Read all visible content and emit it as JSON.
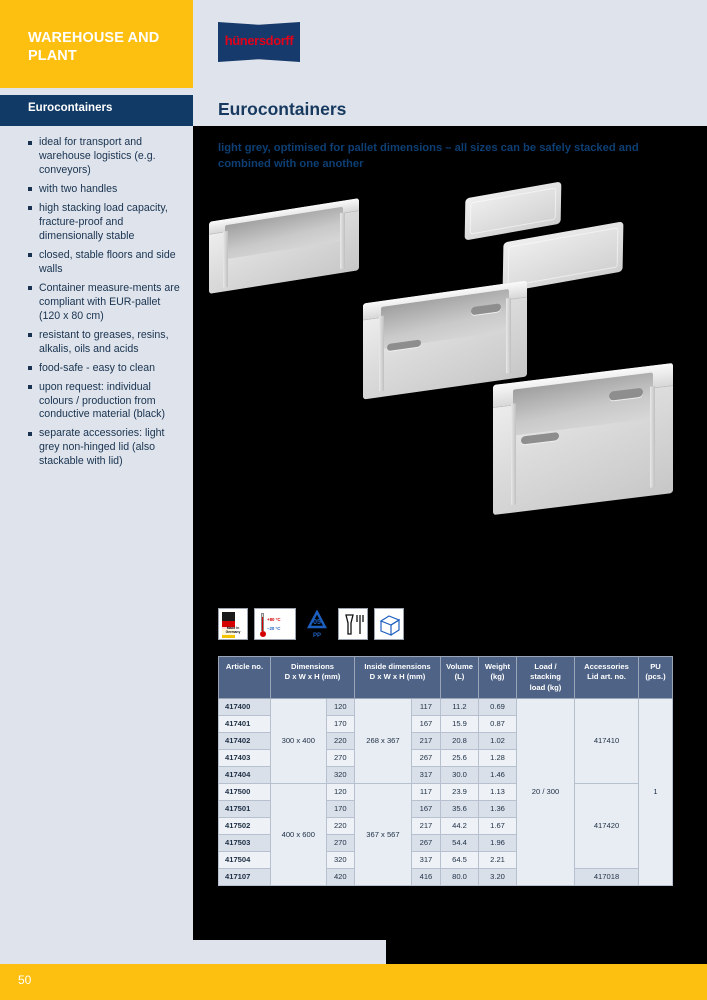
{
  "sidebar": {
    "category": "WAREHOUSE AND PLANT",
    "nav_label": "Eurocontainers",
    "features": [
      "ideal for transport and warehouse logistics (e.g. conveyors)",
      "with two handles",
      "high stacking load capacity, fracture-proof and dimensionally stable",
      "closed, stable floors and side walls",
      "Container measure-ments are compliant with EUR-pallet (120 x 80 cm)",
      "resistant to greases, resins, alkalis, oils and acids",
      "food-safe - easy to clean",
      "upon request: individual colours / production from conductive material (black)",
      "separate accessories: light grey non-hinged lid (also stackable with lid)"
    ]
  },
  "brand": {
    "logo_text": "hünersdorff"
  },
  "main": {
    "title": "Eurocontainers",
    "headline": "light grey, optimised for pallet dimensions – all sizes can be safely stacked and combined with one another"
  },
  "pictograms": [
    {
      "name": "made-in-germany-icon",
      "label": "Made in Germany"
    },
    {
      "name": "temperature-range-icon",
      "temp_high": "+80 °C",
      "temp_low": "–20 °C"
    },
    {
      "name": "recycling-pp-icon",
      "code": "05",
      "material": "PP"
    },
    {
      "name": "food-safe-icon",
      "label": "food safe"
    },
    {
      "name": "dimensions-icon",
      "label": "dimensions"
    }
  ],
  "table": {
    "headers": [
      "Article no.",
      "Dimensions D x W x H (mm)",
      "Inside dimensions D x W x H (mm)",
      "Volume (L)",
      "Weight (kg)",
      "Load / stacking load (kg)",
      "Accessories Lid art. no.",
      "PU (pcs.)"
    ],
    "headers_split": [
      {
        "line1": "Article no.",
        "line2": ""
      },
      {
        "line1": "Dimensions",
        "line2": "D x W x H (mm)"
      },
      {
        "line1": "Inside dimensions",
        "line2": "D x W x H (mm)"
      },
      {
        "line1": "Volume",
        "line2": "(L)"
      },
      {
        "line1": "Weight",
        "line2": "(kg)"
      },
      {
        "line1": "Load /",
        "line2": "stacking",
        "line3": "load (kg)"
      },
      {
        "line1": "Accessories",
        "line2": "Lid art. no."
      },
      {
        "line1": "PU",
        "line2": "(pcs.)"
      }
    ],
    "groups": [
      {
        "footprint": "300 x 400",
        "inside_dw": "268 x 367",
        "lid_art_no": "417410",
        "rows": [
          {
            "article_no": "417400",
            "height": "120",
            "inside_h": "117",
            "volume": "11.2",
            "weight": "0.69"
          },
          {
            "article_no": "417401",
            "height": "170",
            "inside_h": "167",
            "volume": "15.9",
            "weight": "0.87"
          },
          {
            "article_no": "417402",
            "height": "220",
            "inside_h": "217",
            "volume": "20.8",
            "weight": "1.02"
          },
          {
            "article_no": "417403",
            "height": "270",
            "inside_h": "267",
            "volume": "25.6",
            "weight": "1.28"
          },
          {
            "article_no": "417404",
            "height": "320",
            "inside_h": "317",
            "volume": "30.0",
            "weight": "1.46"
          }
        ]
      },
      {
        "footprint": "400 x 600",
        "inside_dw": "367 x 567",
        "lid_art_no": "417420",
        "rows": [
          {
            "article_no": "417500",
            "height": "120",
            "inside_h": "117",
            "volume": "23.9",
            "weight": "1.13"
          },
          {
            "article_no": "417501",
            "height": "170",
            "inside_h": "167",
            "volume": "35.6",
            "weight": "1.36"
          },
          {
            "article_no": "417502",
            "height": "220",
            "inside_h": "217",
            "volume": "44.2",
            "weight": "1.67"
          },
          {
            "article_no": "417503",
            "height": "270",
            "inside_h": "267",
            "volume": "54.4",
            "weight": "1.96"
          },
          {
            "article_no": "417504",
            "height": "320",
            "inside_h": "317",
            "volume": "64.5",
            "weight": "2.21"
          },
          {
            "article_no": "417107",
            "height": "420",
            "inside_h": "416",
            "volume": "80.0",
            "weight": "3.20",
            "lid_art_no": "417018"
          }
        ]
      }
    ],
    "load_stacking": "20 / 300",
    "pu": "1"
  },
  "footer": {
    "page_number": "50"
  },
  "colors": {
    "yellow": "#fdc010",
    "navy": "#123a67",
    "light_blue_grey": "#dfe4ec",
    "table_header": "#4f6386",
    "brand_red": "#e2001a",
    "headline_blue": "#0d3f74"
  }
}
